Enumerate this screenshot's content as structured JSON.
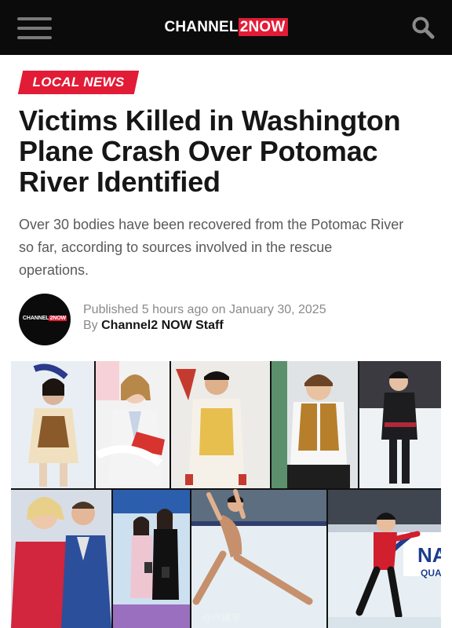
{
  "header": {
    "brand_prefix": "CHANNEL",
    "brand_highlight": "2NOW",
    "menu_icon": "hamburger-menu-icon",
    "search_icon": "search-icon",
    "accent_color": "#e21b36",
    "bar_color": "#0b0b0b"
  },
  "article": {
    "category": "LOCAL NEWS",
    "headline_lines": [
      "Victims Killed in Washington",
      "Plane Crash Over Potomac",
      "River Identified"
    ],
    "summary_lines": [
      "Over 30 bodies have been recovered from the Potomac River",
      "so far, according to sources involved in the rescue",
      "operations."
    ],
    "published_prefix": "Published",
    "published_age": "5 hours ago",
    "published_on_word": "on",
    "published_date": "January 30, 2025",
    "by_word": "By",
    "author": "Channel2 NOW Staff",
    "avatar_logo_prefix": "CHANNEL",
    "avatar_logo_highlight": "2NOW"
  },
  "photo": {
    "description_icon": "photo-collage-image",
    "visible_text": [
      "NA",
      "QUA"
    ],
    "watermark": "@卢建宇"
  }
}
